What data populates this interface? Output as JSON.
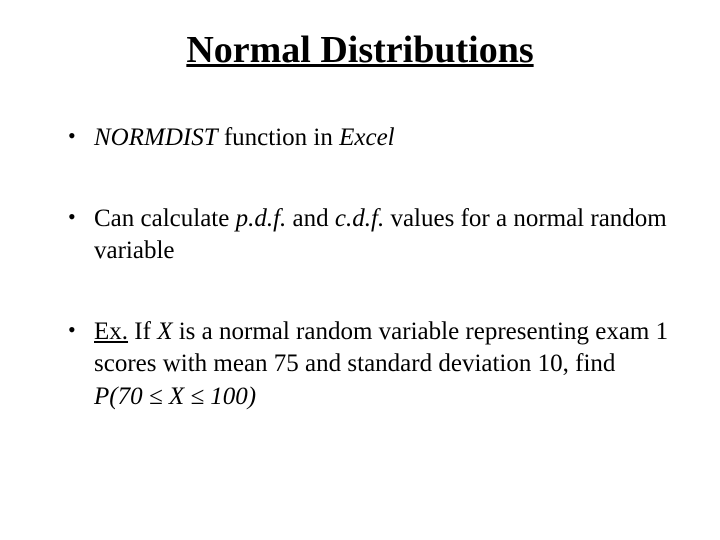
{
  "title": "Normal Distributions",
  "bullets": {
    "b1": {
      "fn": "NORMDIST",
      "mid": " function in ",
      "app": "Excel"
    },
    "b2": {
      "pre": "Can calculate ",
      "pdf": "p.d.f.",
      "and": " and ",
      "cdf": "c.d.f.",
      "post": " values for a normal random variable"
    },
    "b3": {
      "exlabel": "Ex.",
      "sp": " If ",
      "X": "X",
      "rest": " is a normal random variable representing exam 1 scores with mean 75 and standard deviation 10, find  ",
      "formula": "P(70 ≤ X ≤ 100)"
    }
  }
}
